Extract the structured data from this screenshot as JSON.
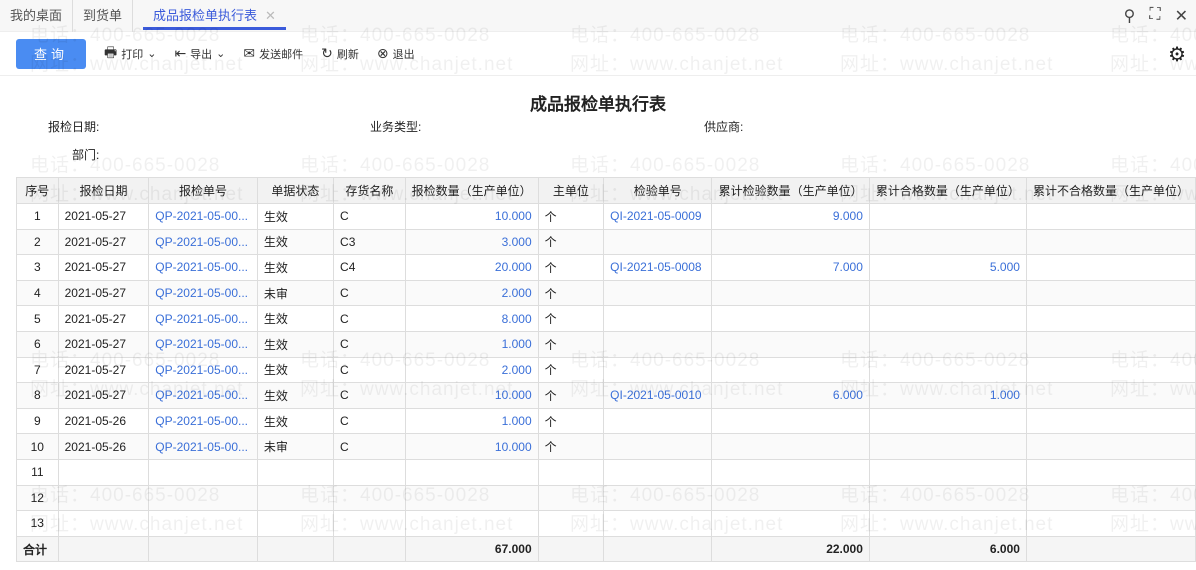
{
  "tabs": [
    "我的桌面",
    "到货单",
    "成品报检单执行表"
  ],
  "toolbar": {
    "query": "查询",
    "print": "打印",
    "export": "导出",
    "email": "发送邮件",
    "refresh": "刷新",
    "exit": "退出"
  },
  "report": {
    "title": "成品报检单执行表"
  },
  "filters": {
    "date": "报检日期:",
    "biz_type": "业务类型:",
    "supplier": "供应商:",
    "dept": "部门:"
  },
  "watermark": {
    "phone": "电话：400-665-0028",
    "site": "网址：www.chanjet.net"
  },
  "columns": [
    "序号",
    "报检日期",
    "报检单号",
    "单据状态",
    "存货名称",
    "报检数量（生产单位）",
    "主单位",
    "检验单号",
    "累计检验数量（生产单位）",
    "累计合格数量（生产单位）",
    "累计不合格数量（生产单位）"
  ],
  "rows": [
    [
      "1",
      "2021-05-27",
      "QP-2021-05-00...",
      "生效",
      "C",
      "10.000",
      "个",
      "QI-2021-05-0009",
      "9.000",
      "",
      ""
    ],
    [
      "2",
      "2021-05-27",
      "QP-2021-05-00...",
      "生效",
      "C3",
      "3.000",
      "个",
      "",
      "",
      "",
      ""
    ],
    [
      "3",
      "2021-05-27",
      "QP-2021-05-00...",
      "生效",
      "C4",
      "20.000",
      "个",
      "QI-2021-05-0008",
      "7.000",
      "5.000",
      ""
    ],
    [
      "4",
      "2021-05-27",
      "QP-2021-05-00...",
      "未审",
      "C",
      "2.000",
      "个",
      "",
      "",
      "",
      ""
    ],
    [
      "5",
      "2021-05-27",
      "QP-2021-05-00...",
      "生效",
      "C",
      "8.000",
      "个",
      "",
      "",
      "",
      ""
    ],
    [
      "6",
      "2021-05-27",
      "QP-2021-05-00...",
      "生效",
      "C",
      "1.000",
      "个",
      "",
      "",
      "",
      ""
    ],
    [
      "7",
      "2021-05-27",
      "QP-2021-05-00...",
      "生效",
      "C",
      "2.000",
      "个",
      "",
      "",
      "",
      ""
    ],
    [
      "8",
      "2021-05-27",
      "QP-2021-05-00...",
      "生效",
      "C",
      "10.000",
      "个",
      "QI-2021-05-0010",
      "6.000",
      "1.000",
      ""
    ],
    [
      "9",
      "2021-05-26",
      "QP-2021-05-00...",
      "生效",
      "C",
      "1.000",
      "个",
      "",
      "",
      "",
      ""
    ],
    [
      "10",
      "2021-05-26",
      "QP-2021-05-00...",
      "未审",
      "C",
      "10.000",
      "个",
      "",
      "",
      "",
      ""
    ],
    [
      "11",
      "",
      "",
      "",
      "",
      "",
      "",
      "",
      "",
      "",
      ""
    ],
    [
      "12",
      "",
      "",
      "",
      "",
      "",
      "",
      "",
      "",
      "",
      ""
    ],
    [
      "13",
      "",
      "",
      "",
      "",
      "",
      "",
      "",
      "",
      "",
      ""
    ]
  ],
  "total": {
    "label": "合计",
    "qty": "67.000",
    "inspected": "22.000",
    "qualified": "6.000"
  }
}
